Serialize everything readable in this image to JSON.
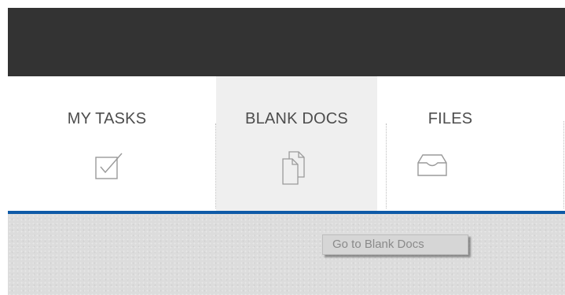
{
  "tabs": [
    {
      "label": "MY TASKS",
      "icon": "checkbox-icon",
      "active": false
    },
    {
      "label": "BLANK DOCS",
      "icon": "documents-icon",
      "active": true
    },
    {
      "label": "FILES",
      "icon": "inbox-tray-icon",
      "active": false
    }
  ],
  "tooltip": {
    "text": "Go to Blank Docs"
  },
  "colors": {
    "header": "#333333",
    "active_tab_bg": "#efefef",
    "accent_line": "#0e5aa7",
    "label_text": "#4d4d4d"
  }
}
